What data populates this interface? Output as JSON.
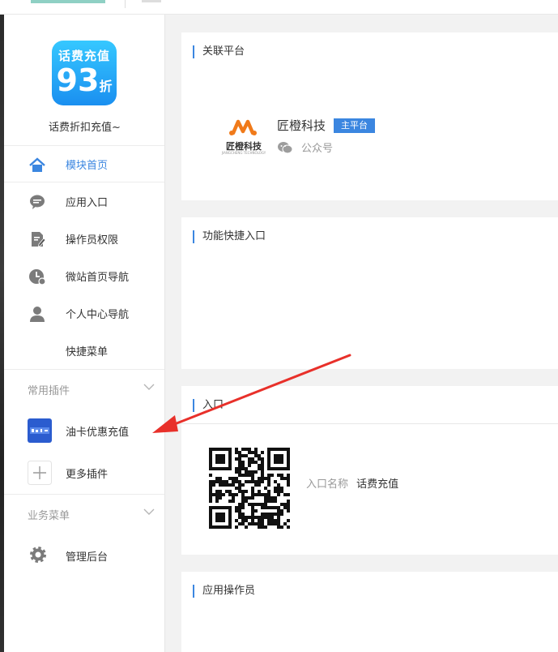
{
  "sidebar": {
    "brand": {
      "icon_line1": "话费充值",
      "icon_number": "93",
      "icon_unit": "折",
      "name": "话费折扣充值~"
    },
    "menu": [
      {
        "label": "模块首页",
        "icon": "home-icon"
      },
      {
        "label": "应用入口",
        "icon": "chat-bubble-icon"
      },
      {
        "label": "操作员权限",
        "icon": "edit-document-icon"
      },
      {
        "label": "微站首页导航",
        "icon": "clock-icon"
      },
      {
        "label": "个人中心导航",
        "icon": "user-icon"
      },
      {
        "label": "快捷菜单",
        "icon": ""
      }
    ],
    "group_plugins": {
      "title": "常用插件",
      "items": [
        {
          "label": "油卡优惠充值"
        },
        {
          "label": "更多插件"
        }
      ]
    },
    "group_business": {
      "title": "业务菜单",
      "items": [
        {
          "label": "管理后台"
        }
      ]
    }
  },
  "main": {
    "linked_platform": {
      "title": "关联平台",
      "name": "匠橙科技",
      "tag": "主平台",
      "type": "公众号",
      "logo_text": "匠橙科技",
      "logo_subtext": "JIANGCHENG TECHNOLOGY"
    },
    "quick_entry": {
      "title": "功能快捷入口"
    },
    "entry": {
      "title": "入口",
      "name_label": "入口名称",
      "name_value": "话费充值"
    },
    "operators": {
      "title": "应用操作员"
    }
  },
  "colors": {
    "accent": "#3b86e0",
    "annotation_arrow": "#e8302a"
  }
}
